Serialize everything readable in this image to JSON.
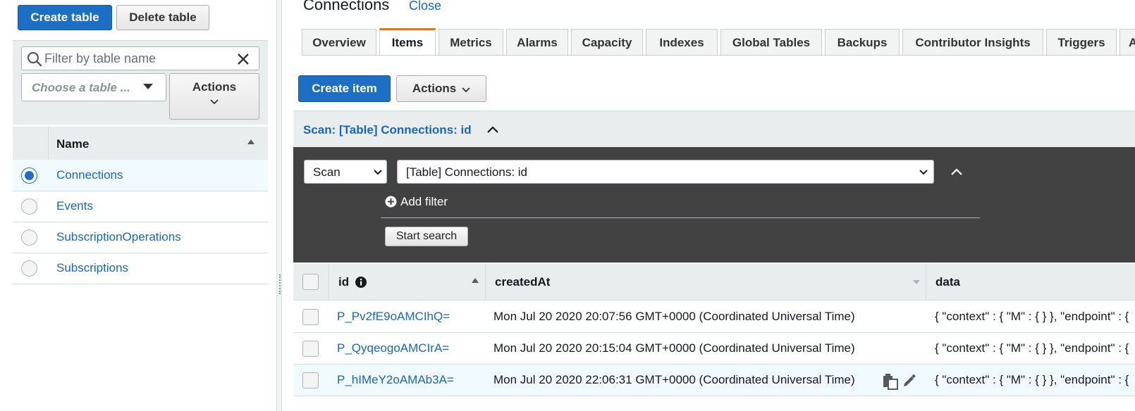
{
  "left": {
    "create_table": "Create table",
    "delete_table": "Delete table",
    "filter_placeholder": "Filter by table name",
    "choose_placeholder": "Choose a table ...",
    "actions": "Actions",
    "column_name": "Name",
    "tables": [
      "Connections",
      "Events",
      "SubscriptionOperations",
      "Subscriptions"
    ],
    "selected_index": 0
  },
  "main": {
    "title": "Connections",
    "close": "Close",
    "tabs": [
      "Overview",
      "Items",
      "Metrics",
      "Alarms",
      "Capacity",
      "Indexes",
      "Global Tables",
      "Backups",
      "Contributor Insights",
      "Triggers",
      "A"
    ],
    "active_tab": "Items",
    "create_item": "Create item",
    "actions": "Actions",
    "scan_header": "Scan: [Table] Connections: id",
    "scan_mode": "Scan",
    "scan_target": "[Table] Connections: id",
    "add_filter": "Add filter",
    "start_search": "Start search",
    "columns": [
      "id",
      "createdAt",
      "data"
    ],
    "rows": [
      {
        "id": "P_Pv2fE9oAMCIhQ=",
        "createdAt": "Mon Jul 20 2020 20:07:56 GMT+0000 (Coordinated Universal Time)",
        "data": "{ \"context\" : { \"M\" : { } }, \"endpoint\" : {"
      },
      {
        "id": "P_QyqeogoAMCIrA=",
        "createdAt": "Mon Jul 20 2020 20:15:04 GMT+0000 (Coordinated Universal Time)",
        "data": "{ \"context\" : { \"M\" : { } }, \"endpoint\" : {"
      },
      {
        "id": "P_hIMeY2oAMAb3A=",
        "createdAt": "Mon Jul 20 2020 22:06:31 GMT+0000 (Coordinated Universal Time)",
        "data": "{ \"context\" : { \"M\" : { } }, \"endpoint\" : {"
      }
    ]
  },
  "colors": {
    "primary": "#1d6fc5",
    "link": "#1a66b8",
    "tab_active": "#ec7211",
    "dark_panel": "#424242",
    "selected_row": "#f1faff"
  }
}
